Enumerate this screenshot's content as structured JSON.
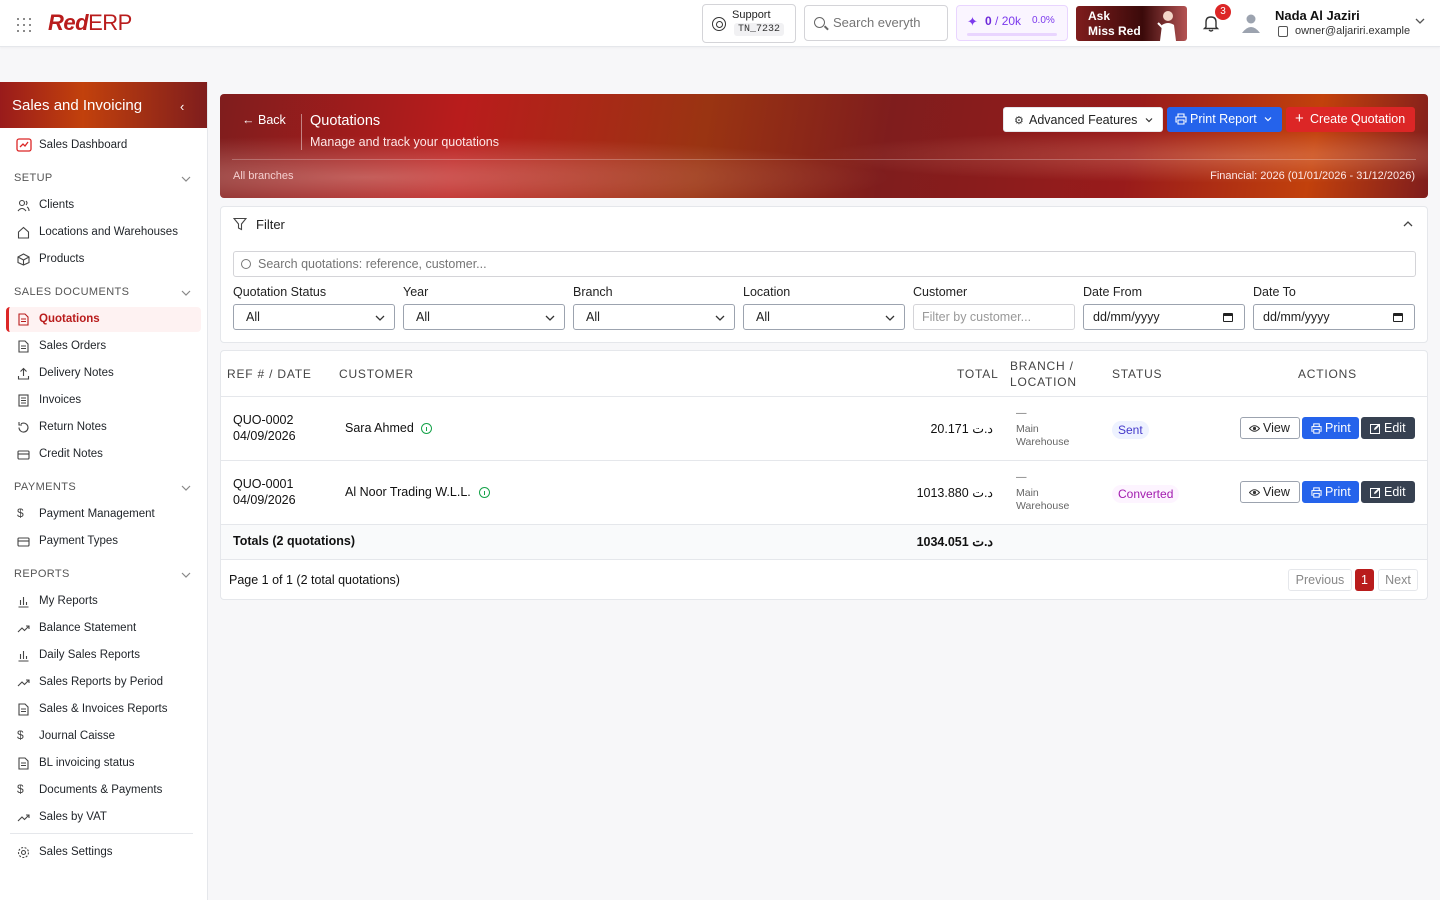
{
  "topbar": {
    "logo_red": "Red",
    "logo_erp": "ERP",
    "support_label": "Support",
    "support_code": "TN_7232",
    "search_placeholder": "Search everyth",
    "credits_used": "0",
    "credits_total": "/ 20k",
    "credits_percent": "0.0%",
    "credits_fraction": 0.0,
    "ask_line1": "Ask",
    "ask_line2": "Miss Red",
    "notification_count": "3",
    "user_name": "Nada Al Jaziri",
    "user_email": "owner@aljariri.example"
  },
  "sidebar": {
    "title": "Sales and Invoicing",
    "dashboard": "Sales Dashboard",
    "sections": {
      "setup": "SETUP",
      "sales_documents": "SALES DOCUMENTS",
      "payments": "PAYMENTS",
      "reports": "REPORTS"
    },
    "setup_items": [
      "Clients",
      "Locations and Warehouses",
      "Products"
    ],
    "sales_items": [
      "Quotations",
      "Sales Orders",
      "Delivery Notes",
      "Invoices",
      "Return Notes",
      "Credit Notes"
    ],
    "payment_items": [
      "Payment Management",
      "Payment Types"
    ],
    "report_items": [
      "My Reports",
      "Balance Statement",
      "Daily Sales Reports",
      "Sales Reports by Period",
      "Sales & Invoices Reports",
      "Journal Caisse",
      "BL invoicing status",
      "Documents & Payments",
      "Sales by VAT"
    ],
    "settings": "Sales Settings"
  },
  "header": {
    "back": "Back",
    "title": "Quotations",
    "subtitle": "Manage and track your quotations",
    "branches": "All branches",
    "financial": "Financial: 2026 (01/01/2026 - 31/12/2026)",
    "advanced_label": "Advanced Features",
    "print_label": "Print Report",
    "create_label": "Create Quotation"
  },
  "filter": {
    "title": "Filter",
    "search_placeholder": "Search quotations: reference, customer...",
    "status_label": "Quotation Status",
    "status_value": "All",
    "year_label": "Year",
    "year_value": "All",
    "branch_label": "Branch",
    "branch_value": "All",
    "location_label": "Location",
    "location_value": "All",
    "customer_label": "Customer",
    "customer_placeholder": "Filter by customer...",
    "date_from_label": "Date From",
    "date_from_value": "dd/mm/yyyy",
    "date_to_label": "Date To",
    "date_to_value": "dd/mm/yyyy"
  },
  "table": {
    "columns": {
      "ref": "REF # / DATE",
      "customer": "CUSTOMER",
      "total": "TOTAL",
      "branch_1": "BRANCH /",
      "branch_2": "LOCATION",
      "status": "STATUS",
      "actions": "ACTIONS"
    },
    "rows": [
      {
        "ref": "QUO-0002",
        "date": "04/09/2026",
        "customer": "Sara Ahmed",
        "total": "20.171 د.ت",
        "branch": "—",
        "loc1": "Main",
        "loc2": "Warehouse",
        "status": "Sent"
      },
      {
        "ref": "QUO-0001",
        "date": "04/09/2026",
        "customer": "Al Noor Trading W.L.L.",
        "total": "1013.880 د.ت",
        "branch": "—",
        "loc1": "Main",
        "loc2": "Warehouse",
        "status": "Converted"
      }
    ],
    "view_label": "View",
    "print_label": "Print",
    "edit_label": "Edit",
    "totals_label": "Totals (2 quotations)",
    "totals_value": "1034.051 د.ت",
    "page_info": "Page 1 of 1 (2 total quotations)",
    "prev": "Previous",
    "current_page": "1",
    "next": "Next"
  }
}
